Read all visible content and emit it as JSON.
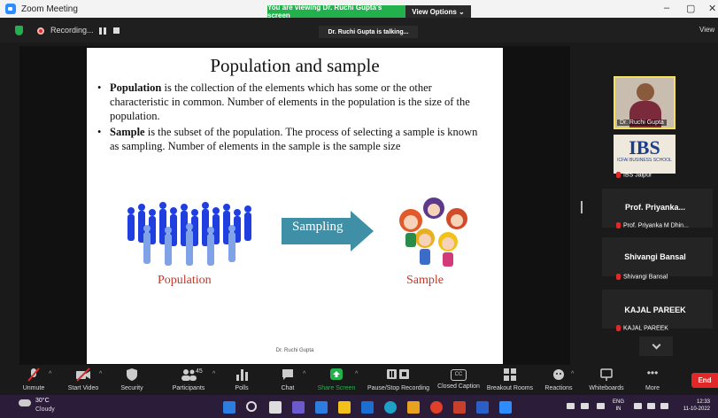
{
  "window": {
    "title": "Zoom Meeting",
    "share_banner": "You are viewing Dr. Ruchi Gupta's screen",
    "view_options": "View Options ⌄",
    "controls": [
      "–",
      "▢",
      "✕"
    ]
  },
  "meeting_bar": {
    "recording_label": "Recording...",
    "talking": "Dr. Ruchi Gupta is talking...",
    "view_label": "View"
  },
  "slide": {
    "title": "Population and sample",
    "bullets": [
      {
        "term": "Population",
        "text": " is the collection of the elements which has some or the other characteristic in common. Number of elements in the population is the size of the population."
      },
      {
        "term": "Sample",
        "text": " is the subset of the population. The process of selecting a sample is known as sampling. Number of elements in the sample is the sample size"
      }
    ],
    "arrow_label": "Sampling",
    "left_caption": "Population",
    "right_caption": "Sample",
    "footer": "Dr. Ruchi Gupta"
  },
  "participants": [
    {
      "name": "Dr. Ruchi Gupta",
      "type": "video"
    },
    {
      "name": "IBS Jaipur",
      "type": "logo",
      "logo": "IBS",
      "logo_sub": "ICFAI BUSINESS SCHOOL"
    },
    {
      "display": "Prof. Priyanka...",
      "name": "Prof. Priyanka M Dhin..."
    },
    {
      "display": "Shivangi Bansal",
      "name": "Shivangi Bansal"
    },
    {
      "display": "KAJAL PAREEK",
      "name": "KAJAL PAREEK"
    }
  ],
  "toolbar": {
    "unmute": "Unmute",
    "start_video": "Start Video",
    "security": "Security",
    "participants": "Participants",
    "participants_count": "45",
    "polls": "Polls",
    "chat": "Chat",
    "share_screen": "Share Screen",
    "pause_recording": "Pause/Stop Recording",
    "closed_caption": "Closed Caption",
    "breakout_rooms": "Breakout Rooms",
    "reactions": "Reactions",
    "whiteboards": "Whiteboards",
    "more": "More",
    "end": "End",
    "cc_glyph": "CC"
  },
  "taskbar": {
    "temperature": "30°C",
    "weather": "Cloudy",
    "lang1": "ENG",
    "lang2": "IN",
    "time": "12:33",
    "date": "11-10-2022"
  },
  "colors": {
    "share_green": "#23b14d",
    "end_red": "#e02828",
    "caption_red": "#c0392b",
    "arrow_teal": "#3f8fa6",
    "crowd_blue": "#1f3fe0"
  }
}
